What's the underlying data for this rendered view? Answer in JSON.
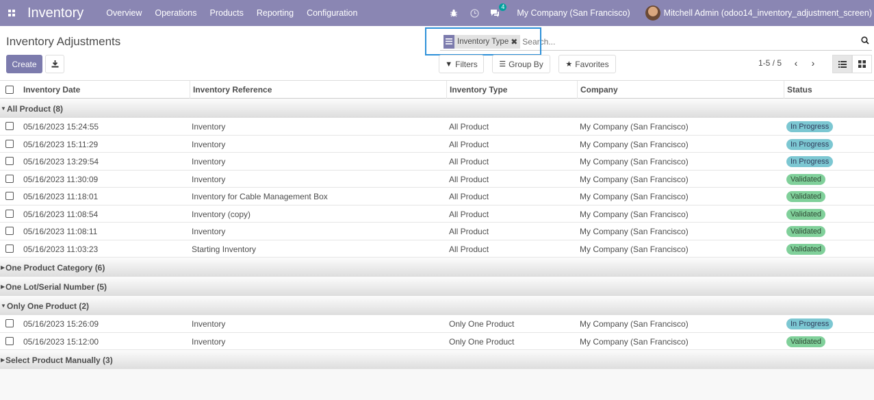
{
  "navbar": {
    "brand": "Inventory",
    "menu": [
      "Overview",
      "Operations",
      "Products",
      "Reporting",
      "Configuration"
    ],
    "message_count": "4",
    "company": "My Company (San Francisco)",
    "user": "Mitchell Admin (odoo14_inventory_adjustment_screen)"
  },
  "control": {
    "title": "Inventory Adjustments",
    "facet_label": "Inventory Type",
    "search_placeholder": "Search...",
    "create_label": "Create",
    "filters_label": "Filters",
    "groupby_label": "Group By",
    "favorites_label": "Favorites",
    "pager": "1-5 / 5"
  },
  "table": {
    "columns": [
      "Inventory Date",
      "Inventory Reference",
      "Inventory Type",
      "Company",
      "Status"
    ],
    "groups": [
      {
        "name": "All Product (8)",
        "open": true,
        "rows": [
          {
            "date": "05/16/2023 15:24:55",
            "ref": "Inventory",
            "type": "All Product",
            "company": "My Company (San Francisco)",
            "status": "In Progress"
          },
          {
            "date": "05/16/2023 15:11:29",
            "ref": "Inventory",
            "type": "All Product",
            "company": "My Company (San Francisco)",
            "status": "In Progress"
          },
          {
            "date": "05/16/2023 13:29:54",
            "ref": "Inventory",
            "type": "All Product",
            "company": "My Company (San Francisco)",
            "status": "In Progress"
          },
          {
            "date": "05/16/2023 11:30:09",
            "ref": "Inventory",
            "type": "All Product",
            "company": "My Company (San Francisco)",
            "status": "Validated"
          },
          {
            "date": "05/16/2023 11:18:01",
            "ref": "Inventory for Cable Management Box",
            "type": "All Product",
            "company": "My Company (San Francisco)",
            "status": "Validated"
          },
          {
            "date": "05/16/2023 11:08:54",
            "ref": "Inventory (copy)",
            "type": "All Product",
            "company": "My Company (San Francisco)",
            "status": "Validated"
          },
          {
            "date": "05/16/2023 11:08:11",
            "ref": "Inventory",
            "type": "All Product",
            "company": "My Company (San Francisco)",
            "status": "Validated"
          },
          {
            "date": "05/16/2023 11:03:23",
            "ref": "Starting Inventory",
            "type": "All Product",
            "company": "My Company (San Francisco)",
            "status": "Validated"
          }
        ]
      },
      {
        "name": "One Product Category (6)",
        "open": false,
        "rows": []
      },
      {
        "name": "One Lot/Serial Number (5)",
        "open": false,
        "rows": []
      },
      {
        "name": "Only One Product (2)",
        "open": true,
        "rows": [
          {
            "date": "05/16/2023 15:26:09",
            "ref": "Inventory",
            "type": "Only One Product",
            "company": "My Company (San Francisco)",
            "status": "In Progress"
          },
          {
            "date": "05/16/2023 15:12:00",
            "ref": "Inventory",
            "type": "Only One Product",
            "company": "My Company (San Francisco)",
            "status": "Validated"
          }
        ]
      },
      {
        "name": "Select Product Manually (3)",
        "open": false,
        "rows": []
      }
    ]
  }
}
